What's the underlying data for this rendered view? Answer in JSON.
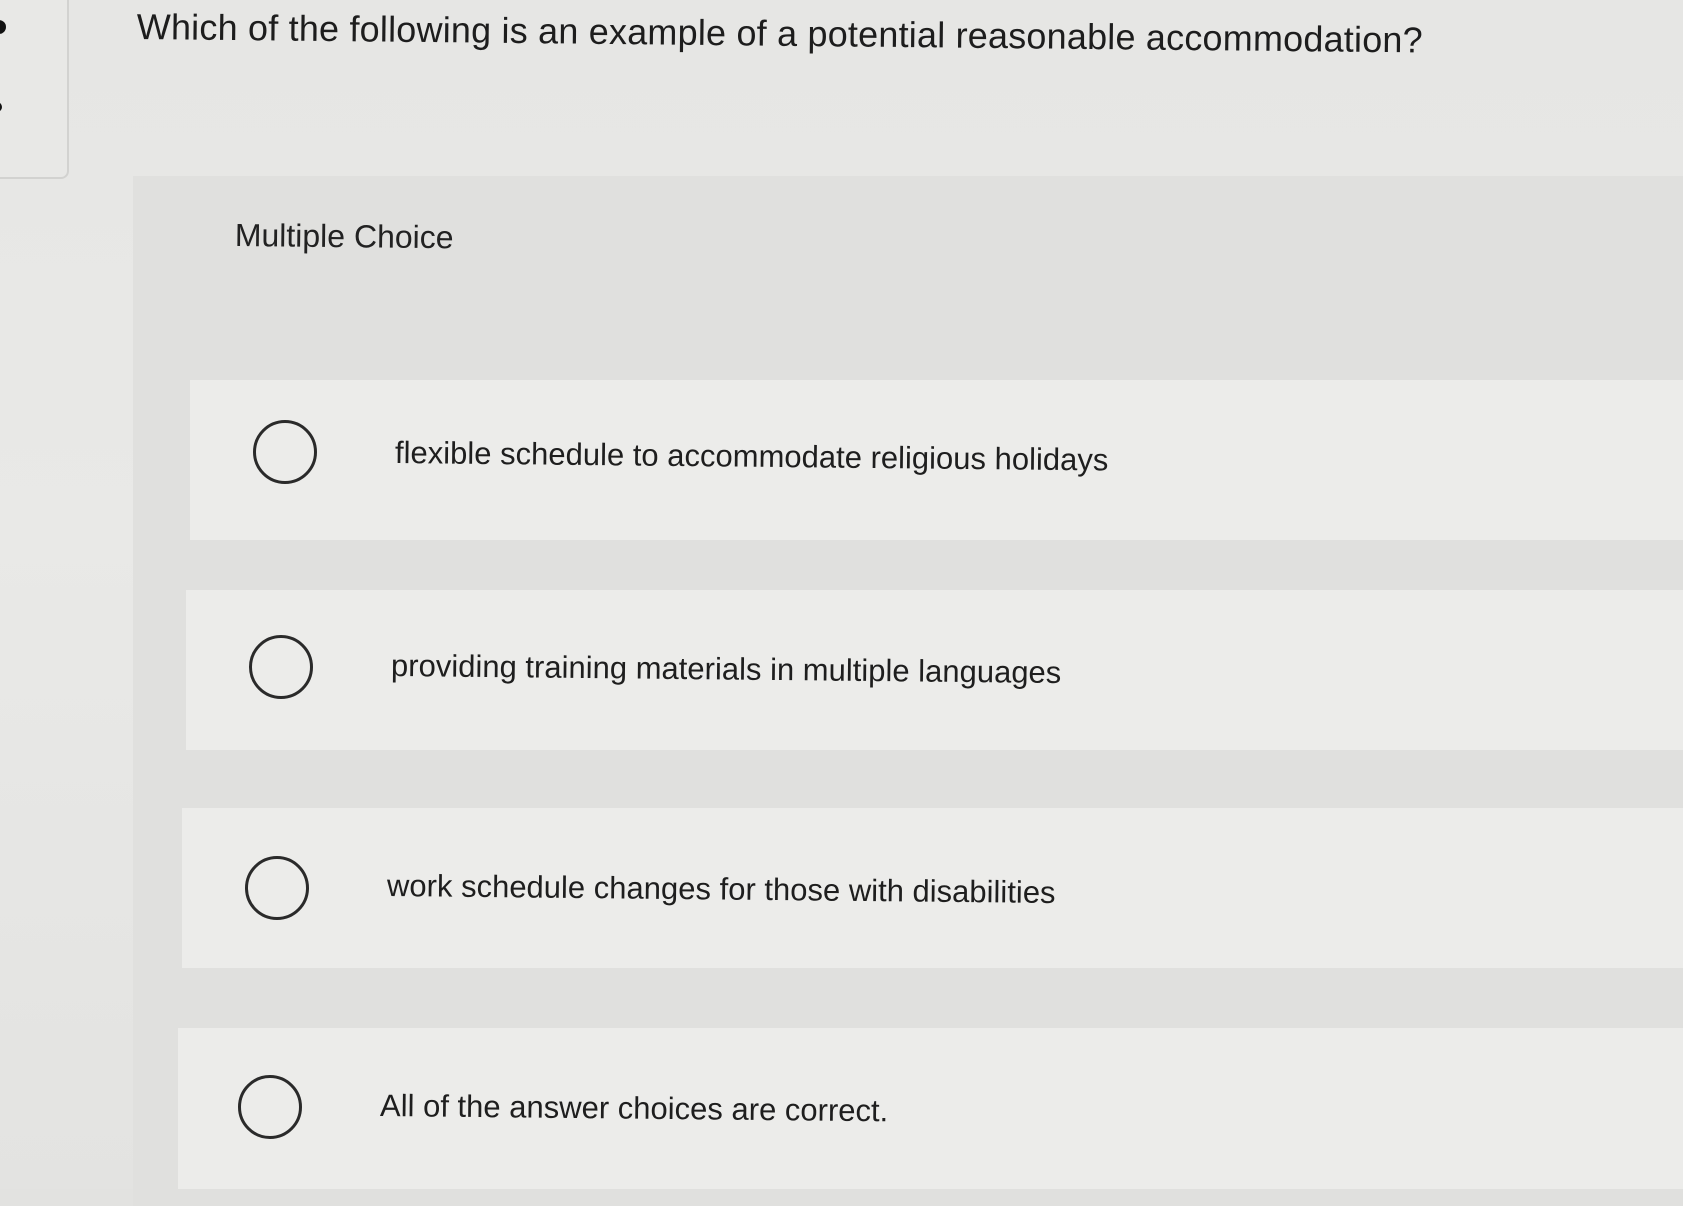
{
  "question": {
    "text": "Which of the following is an example of a potential reasonable accommodation?"
  },
  "section": {
    "label": "Multiple Choice"
  },
  "choices": [
    {
      "label": "flexible schedule to accommodate religious holidays",
      "selected": false
    },
    {
      "label": "providing training materials in multiple languages",
      "selected": false
    },
    {
      "label": "work schedule changes for those with disabilities",
      "selected": false
    },
    {
      "label": "All of the answer choices are correct.",
      "selected": false
    }
  ],
  "colors": {
    "background": "#e6e6e4",
    "panel": "#e0e0de",
    "choice_row": "#ececea",
    "text": "#1e1e1e",
    "radio_border": "#2a2a2a"
  }
}
